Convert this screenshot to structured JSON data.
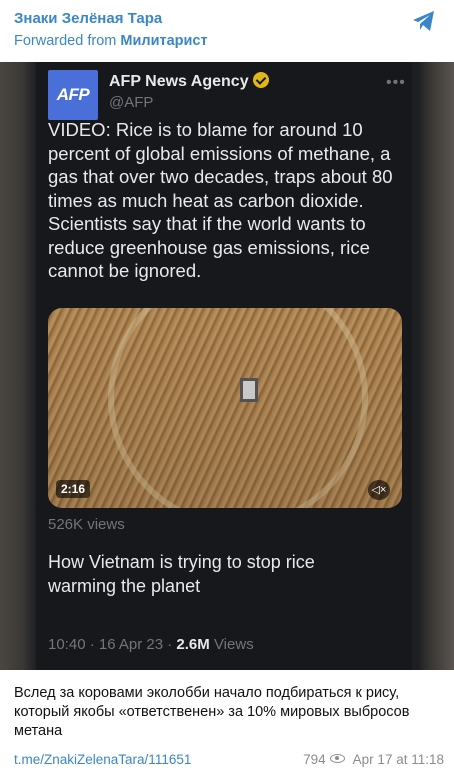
{
  "channel": {
    "name": "Знаки Зелёная Тара",
    "forwarded_prefix": "Forwarded from ",
    "forwarded_source": "Милитарист"
  },
  "tweet": {
    "avatar_text": "AFP",
    "author": "AFP News Agency",
    "handle": "@AFP",
    "text": "VIDEO: Rice is to blame for around 10 percent of global emissions of methane, a gas that over two decades, traps about 80 times as much heat as carbon dioxide. Scientists say that if the world wants to reduce greenhouse gas emissions, rice cannot be ignored.",
    "video_duration": "2:16",
    "views_label": "526K views",
    "card_title": "How Vietnam is trying to stop rice warming the planet",
    "time": "10:40 · 16 Apr 23 · ",
    "total_views": "2.6M",
    "views_word": " Views"
  },
  "caption": "Вслед за коровами эколобби начало подбираться к рису, который якобы «ответственен» за 10% мировых выбросов метана",
  "footer": {
    "link": "t.me/ZnakiZelenaTara/111651",
    "views": "794",
    "date": "Apr 17 at 11:18"
  },
  "colors": {
    "accent": "#3a87c7",
    "tweet_bg": "#16181c",
    "verified": "#e2b719"
  },
  "icons": [
    "telegram-icon",
    "verified-badge-icon",
    "more-options-icon",
    "mute-icon",
    "eye-icon"
  ]
}
